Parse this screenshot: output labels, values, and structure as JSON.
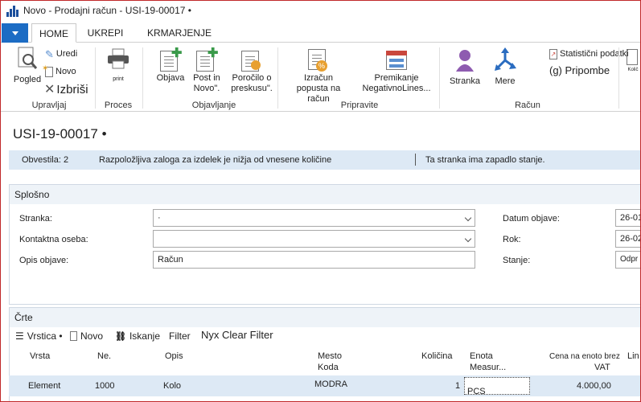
{
  "window": {
    "title": "Novo - Prodajni račun - USI-19-00017 •"
  },
  "tabs": [
    {
      "label": "HOME"
    },
    {
      "label": "UKREPI"
    },
    {
      "label": "KRMARJENJE"
    }
  ],
  "ribbon": {
    "manage": {
      "group_label": "Upravljaj",
      "view": "Pogled",
      "edit": "Uredi",
      "new": "Novo",
      "delete": "Izbriši"
    },
    "process": {
      "group_label": "Proces",
      "print": "print"
    },
    "post": {
      "group_label": "Objavljanje",
      "post": "Objava",
      "post_new": "Post in Novo\".",
      "preview": "Poročilo o preskusu\"."
    },
    "prepare": {
      "group_label": "Pripravite",
      "discount": "Izračun popusta na račun",
      "move_negative": "Premikanje NegativnoLines..."
    },
    "invoice": {
      "group_label": "Račun",
      "customer": "Stranka",
      "dimensions": "Mere",
      "statistics": "Statistični podatki",
      "comments": "(g) Pripombe",
      "cut_label": "Količ"
    }
  },
  "page": {
    "doc_title": "USI-19-00017 •",
    "notifications": {
      "count": "Obvestila: 2",
      "msg1": "Razpoložljiva zaloga za izdelek je nižja od vnesene količine",
      "msg2": "Ta stranka ima zapadlo stanje."
    }
  },
  "general": {
    "title": "Splošno",
    "customer_label": "Stranka:",
    "customer_value": "·",
    "contact_label": "Kontaktna oseba:",
    "contact_value": "",
    "desc_label": "Opis objave:",
    "desc_value": "Račun",
    "posting_date_label": "Datum objave:",
    "posting_date_value": "26-01",
    "due_date_label": "Rok:",
    "due_date_value": "26-02",
    "status_label": "Stanje:",
    "status_value": "Odpr"
  },
  "lines": {
    "title": "Črte",
    "toolbar": {
      "line": "Vrstica •",
      "new": "Novo",
      "find": "Iskanje",
      "filter": "Filter",
      "clear_filter": "Nyx Clear Filter"
    },
    "columns": {
      "type": "Vrsta",
      "no": "Ne.",
      "description": "Opis",
      "location_1": "Mesto",
      "location_2": "Koda",
      "quantity": "Količina",
      "uom_1": "Enota",
      "uom_2": "Measur...",
      "price_1": "Cena na enoto brez",
      "price_2": "VAT",
      "line_cut": "Lin"
    },
    "rows": [
      {
        "type": "Element",
        "no": "1000",
        "description": "Kolo",
        "location": "MODRA",
        "quantity": "1",
        "uom": "PCS",
        "price": "4.000,00"
      }
    ]
  }
}
